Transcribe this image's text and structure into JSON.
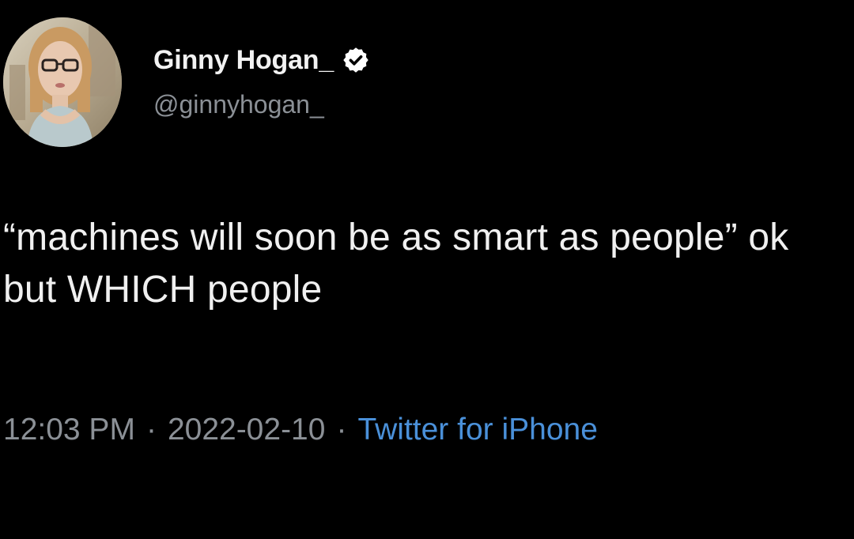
{
  "author": {
    "display_name": "Ginny Hogan_",
    "handle": "@ginnyhogan_",
    "verified_icon": "verified-badge-icon",
    "avatar": "profile-photo"
  },
  "tweet": {
    "text": "“machines will soon be as smart as people” ok but WHICH people"
  },
  "meta": {
    "time": "12:03 PM",
    "separator": "·",
    "date": "2022-02-10",
    "source": "Twitter for iPhone"
  },
  "colors": {
    "background": "#000000",
    "text": "#f0f0f0",
    "muted": "#8b9096",
    "link": "#4a90d9"
  }
}
